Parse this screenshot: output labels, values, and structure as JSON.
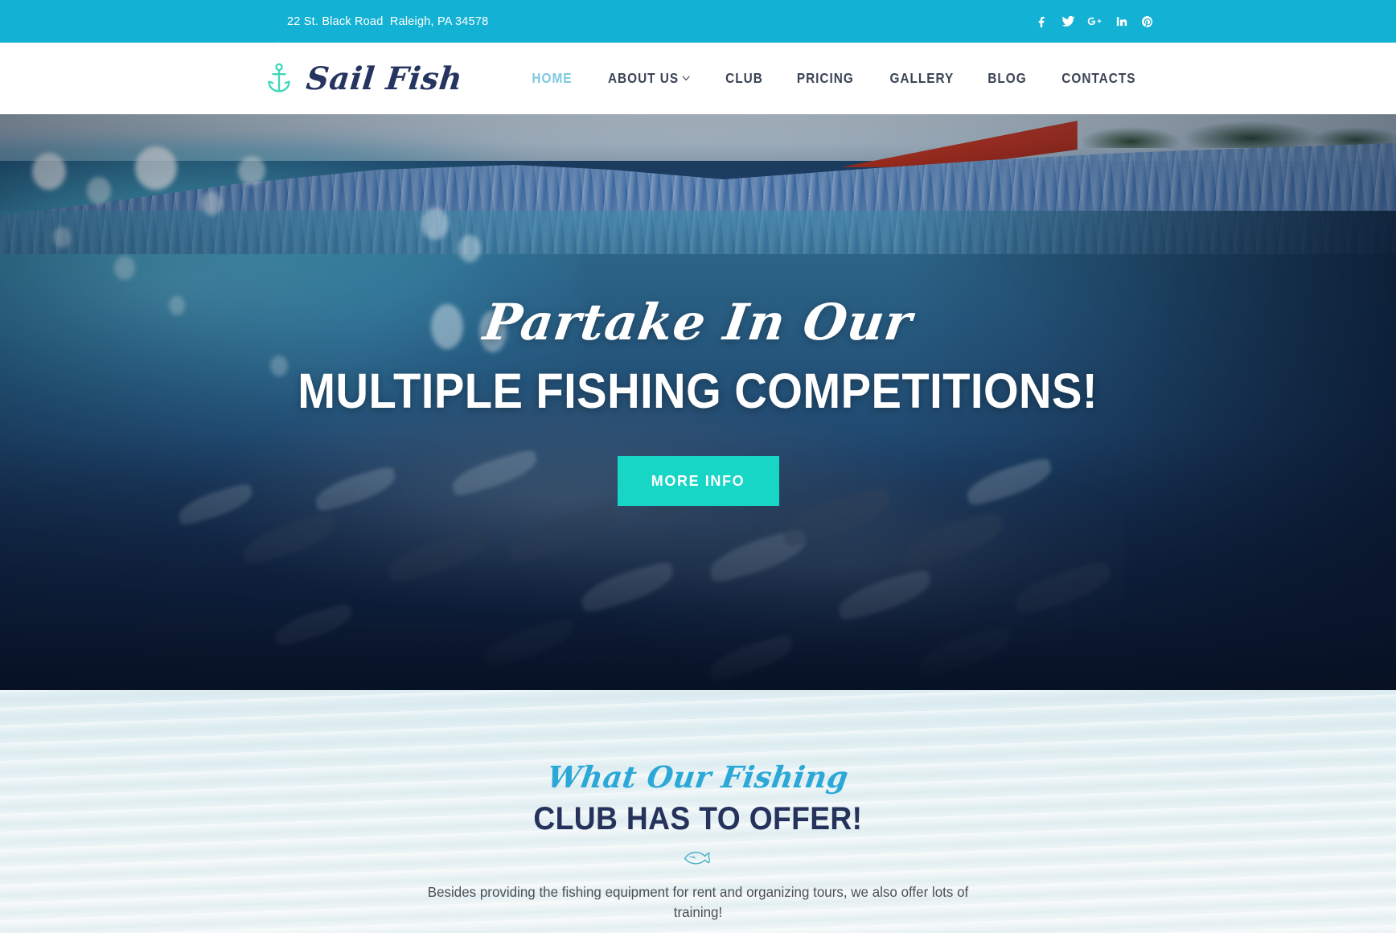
{
  "topbar": {
    "address": "22 St. Black Road  Raleigh, PA 34578",
    "location_icon": "location-arrow-icon",
    "background_color": "#13b2d4",
    "social": [
      {
        "name": "facebook",
        "label": "Facebook"
      },
      {
        "name": "twitter",
        "label": "Twitter"
      },
      {
        "name": "google-plus",
        "label": "Google Plus"
      },
      {
        "name": "linkedin",
        "label": "LinkedIn"
      },
      {
        "name": "pinterest",
        "label": "Pinterest"
      }
    ]
  },
  "header": {
    "logo_icon": "anchor-icon",
    "logo_icon_color": "#3dd6bb",
    "brand": "Sail Fish",
    "brand_color": "#26355f",
    "nav": [
      {
        "label": "HOME",
        "active": true,
        "dropdown": false
      },
      {
        "label": "ABOUT US",
        "active": false,
        "dropdown": true
      },
      {
        "label": "CLUB",
        "active": false,
        "dropdown": false
      },
      {
        "label": "PRICING",
        "active": false,
        "dropdown": false
      },
      {
        "label": "GALLERY",
        "active": false,
        "dropdown": false
      },
      {
        "label": "BLOG",
        "active": false,
        "dropdown": false
      },
      {
        "label": "CONTACTS",
        "active": false,
        "dropdown": false
      }
    ],
    "active_color": "#7ec9e2",
    "inactive_color": "#3b4456"
  },
  "hero": {
    "headline_script": "Partake In Our",
    "headline_bold": "MULTIPLE FISHING COMPETITIONS!",
    "cta_label": "MORE INFO",
    "cta_color": "#17d6c6",
    "image_description": "underwater split-level photo of a school of fish beneath the ocean surface with a red boat hull"
  },
  "offer": {
    "script_title": "What Our Fishing",
    "script_color": "#2ba8d8",
    "main_title": "CLUB HAS TO OFFER!",
    "main_title_color": "#24325c",
    "divider_icon": "fish-icon",
    "divider_color": "#4bafc7",
    "paragraph": "Besides providing the fishing equipment for rent and organizing tours, we also offer lots of training!",
    "background_color": "#e9f3f5"
  }
}
